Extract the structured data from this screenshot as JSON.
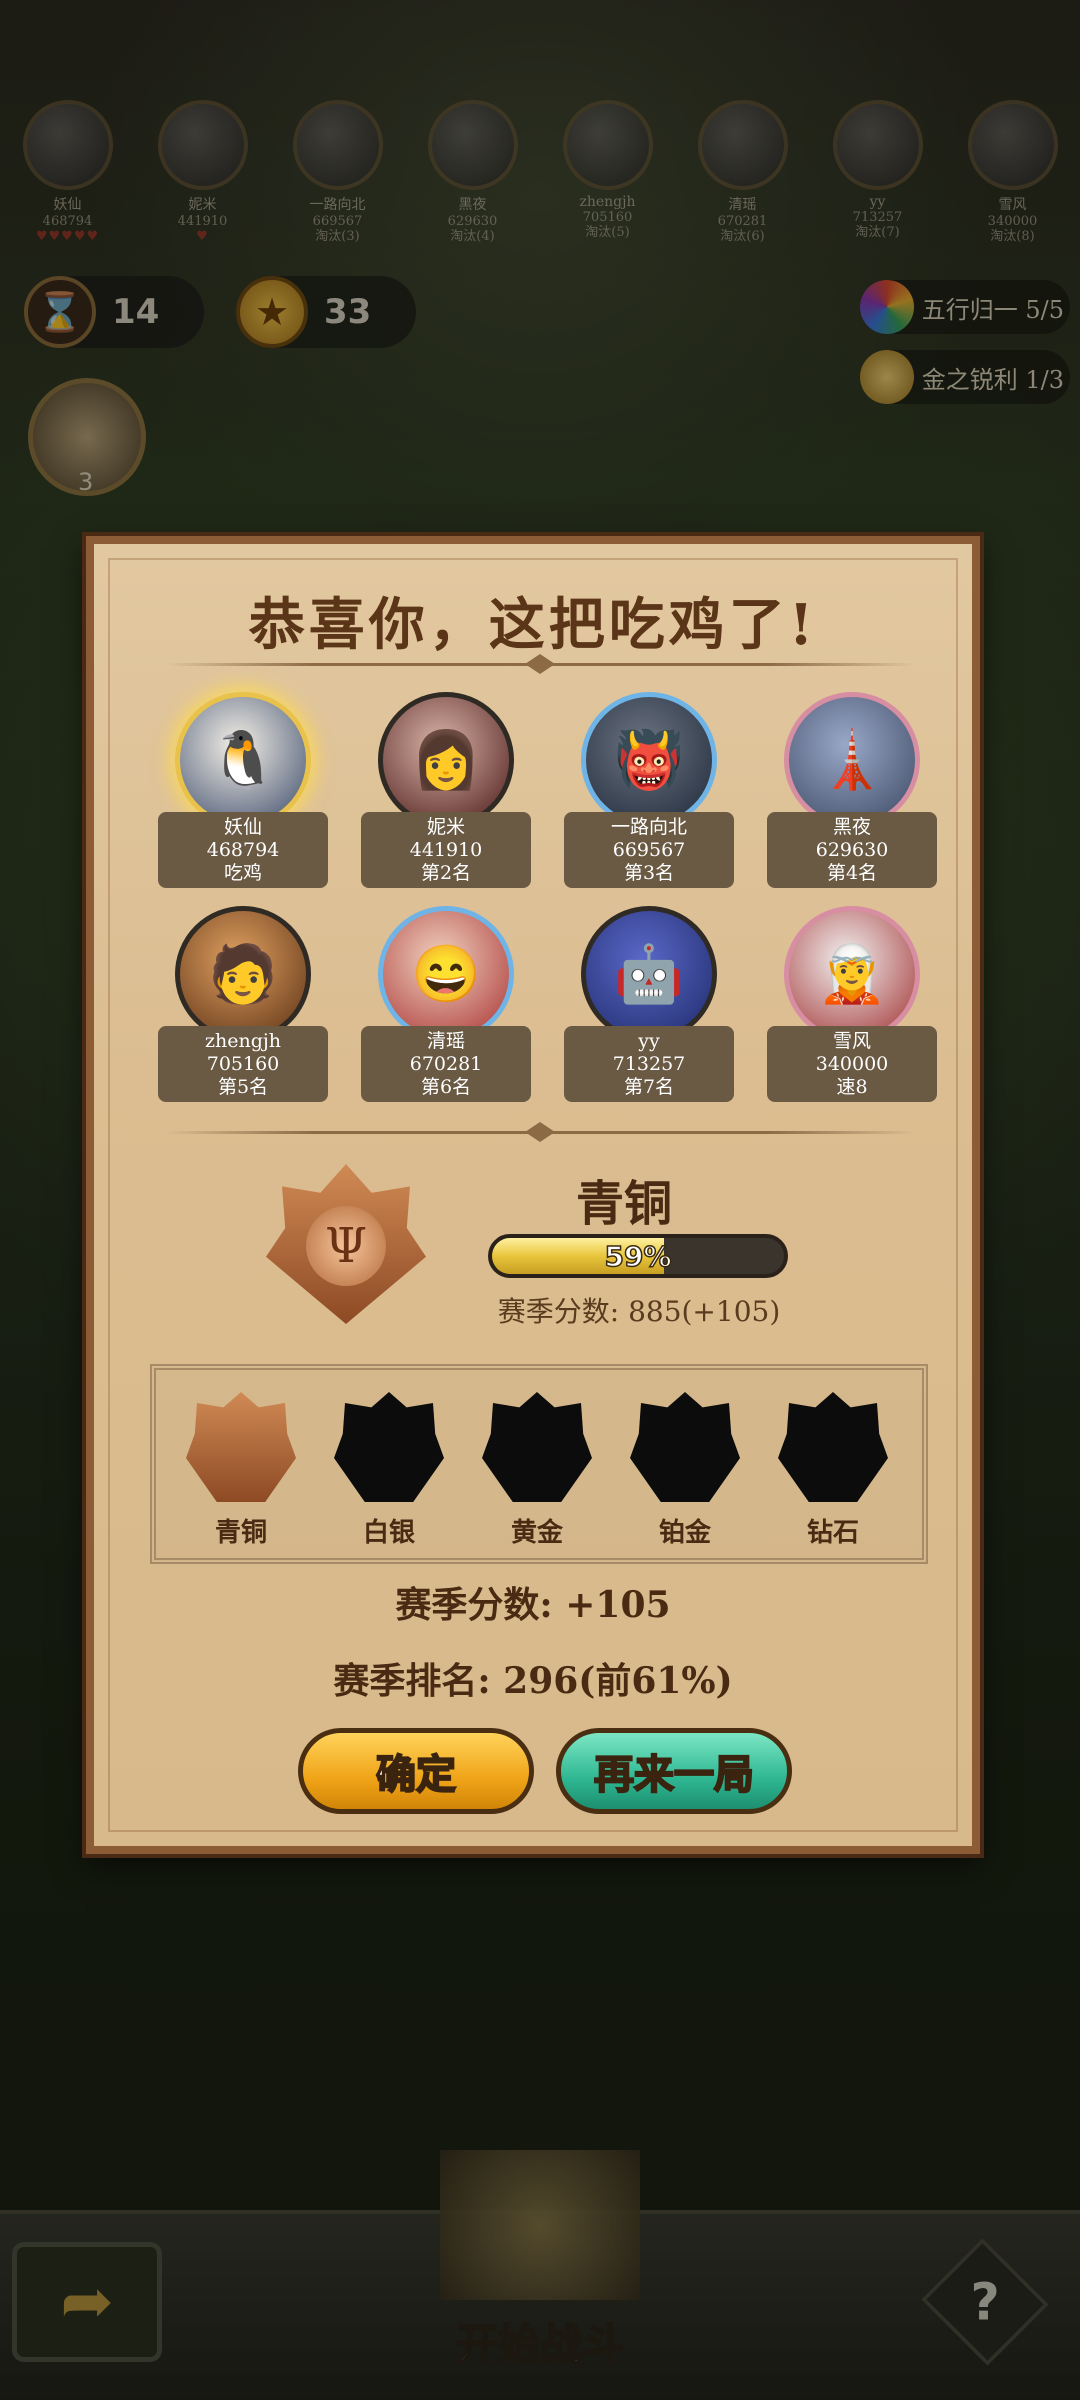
{
  "top_players": [
    {
      "name": "妖仙",
      "score": "468794",
      "status": "",
      "hearts": "♥♥♥♥♥",
      "avatar": "🐧"
    },
    {
      "name": "妮米",
      "score": "441910",
      "status": "",
      "hearts": "♥",
      "avatar": "👩"
    },
    {
      "name": "一路向北",
      "score": "669567",
      "status": "淘汰(3)",
      "hearts": "",
      "avatar": "👹"
    },
    {
      "name": "黑夜",
      "score": "629630",
      "status": "淘汰(4)",
      "hearts": "",
      "avatar": "🗼"
    },
    {
      "name": "zhengjh",
      "score": "705160",
      "status": "淘汰(5)",
      "hearts": "",
      "avatar": "🧑"
    },
    {
      "name": "清瑶",
      "score": "670281",
      "status": "淘汰(6)",
      "hearts": "",
      "avatar": "😄"
    },
    {
      "name": "yy",
      "score": "713257",
      "status": "淘汰(7)",
      "hearts": "",
      "avatar": "🤖"
    },
    {
      "name": "雪风",
      "score": "340000",
      "status": "淘汰(8)",
      "hearts": "",
      "avatar": "🧝"
    }
  ],
  "resources": {
    "time": "14",
    "coins": "33",
    "skill_count": "3"
  },
  "synergies": [
    {
      "label": "五行归一 5/5",
      "icon": "five-elements-icon"
    },
    {
      "label": "金之锐利 1/3",
      "icon": "metal-icon"
    }
  ],
  "modal": {
    "title": "恭喜你，这把吃鸡了!",
    "players": [
      {
        "name": "妖仙",
        "score": "468794",
        "place": "吃鸡",
        "avatar": "🐧",
        "frame": "gold",
        "c1": "#f3efe6",
        "c2": "#3a4a6a"
      },
      {
        "name": "妮米",
        "score": "441910",
        "place": "第2名",
        "avatar": "👩",
        "frame": "dark",
        "c1": "#d9b4a8",
        "c2": "#4a1818"
      },
      {
        "name": "一路向北",
        "score": "669567",
        "place": "第3名",
        "avatar": "👹",
        "frame": "blue",
        "c1": "#6c7482",
        "c2": "#1e2838"
      },
      {
        "name": "黑夜",
        "score": "629630",
        "place": "第4名",
        "avatar": "🗼",
        "frame": "pink",
        "c1": "#9aa8c8",
        "c2": "#3a4862"
      },
      {
        "name": "zhengjh",
        "score": "705160",
        "place": "第5名",
        "avatar": "🧑",
        "frame": "dark",
        "c1": "#e0a060",
        "c2": "#5a3014"
      },
      {
        "name": "清瑶",
        "score": "670281",
        "place": "第6名",
        "avatar": "😄",
        "frame": "blue",
        "c1": "#f0d2c0",
        "c2": "#a83030"
      },
      {
        "name": "yy",
        "score": "713257",
        "place": "第7名",
        "avatar": "🤖",
        "frame": "dark",
        "c1": "#5a68c8",
        "c2": "#1e2a6a"
      },
      {
        "name": "雪风",
        "score": "340000",
        "place": "速8",
        "avatar": "🧝",
        "frame": "pink",
        "c1": "#f2f0f0",
        "c2": "#a03030"
      }
    ],
    "rank": {
      "tier": "青铜",
      "progress_pct": 59,
      "progress_label": "59%",
      "season_points": "赛季分数: 885(+105)"
    },
    "tiers": [
      "青铜",
      "白银",
      "黄金",
      "铂金",
      "钻石"
    ],
    "season_score": "赛季分数: +105",
    "season_rank": "赛季排名: 296(前61%)",
    "confirm_label": "确定",
    "again_label": "再来一局"
  },
  "bottom": {
    "start_label": "开始战斗",
    "back_icon": "arrow-back-icon",
    "help_label": "?"
  },
  "colors": {
    "bronze": "#b36a3a",
    "gold_button": "#f0a418",
    "teal_button": "#2fb792",
    "panel": "#dbbd91"
  }
}
